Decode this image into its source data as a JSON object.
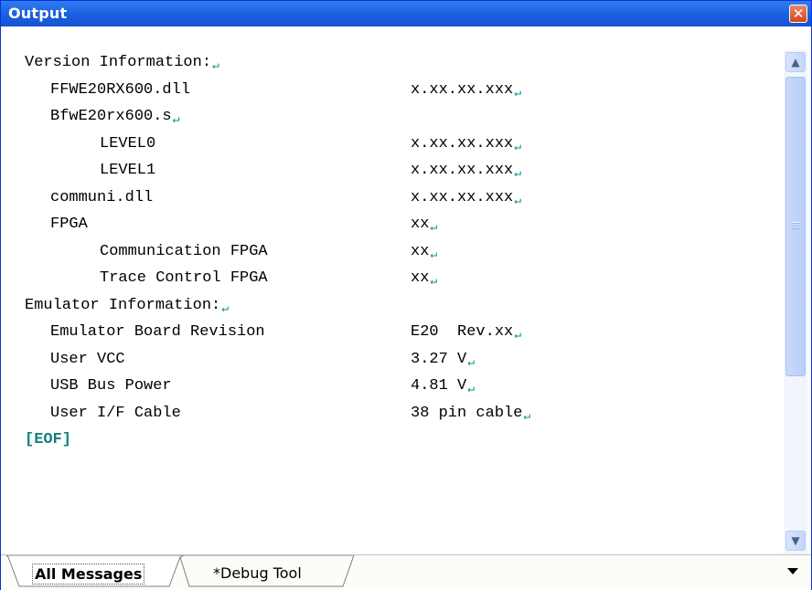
{
  "window": {
    "title": "Output",
    "close_glyph": "✕"
  },
  "output": {
    "lines": [
      {
        "label": "Version Information:",
        "value": "",
        "indent": 0
      },
      {
        "label": "FFWE20RX600.dll",
        "value": "x.xx.xx.xxx",
        "indent": 1
      },
      {
        "label": "BfwE20rx600.s",
        "value": "",
        "indent": 1
      },
      {
        "label": "LEVEL0",
        "value": "x.xx.xx.xxx",
        "indent": 2
      },
      {
        "label": "LEVEL1",
        "value": "x.xx.xx.xxx",
        "indent": 2
      },
      {
        "label": "communi.dll",
        "value": "x.xx.xx.xxx",
        "indent": 1
      },
      {
        "label": "FPGA",
        "value": "xx",
        "indent": 1
      },
      {
        "label": "Communication FPGA",
        "value": "xx",
        "indent": 2
      },
      {
        "label": "Trace Control FPGA",
        "value": "xx",
        "indent": 2
      },
      {
        "label": "Emulator Information:",
        "value": "",
        "indent": 0
      },
      {
        "label": "Emulator Board Revision",
        "value": "E20  Rev.xx",
        "indent": 1
      },
      {
        "label": "User VCC",
        "value": "3.27 V",
        "indent": 1
      },
      {
        "label": "USB Bus Power",
        "value": "4.81 V",
        "indent": 1
      },
      {
        "label": "User I/F Cable",
        "value": "38 pin cable",
        "indent": 1
      }
    ],
    "eof_marker": "[EOF]",
    "newline_glyph": "↵"
  },
  "scrollbar": {
    "up_glyph": "▲",
    "down_glyph": "▼"
  },
  "tabs": [
    {
      "label": "All Messages",
      "active": true
    },
    {
      "label": "*Debug Tool",
      "active": false
    }
  ]
}
